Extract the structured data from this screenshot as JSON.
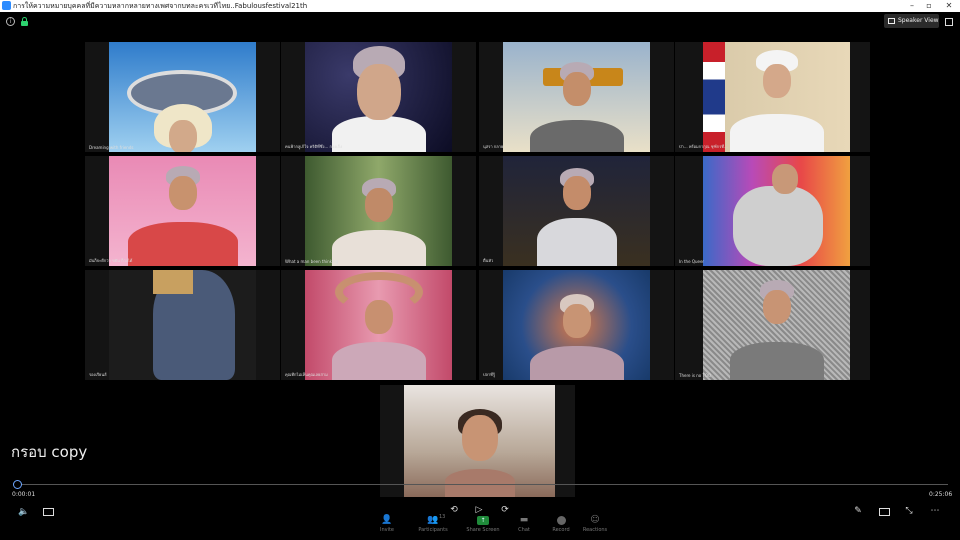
{
  "window": {
    "title": "การให้ความหมายบุคคลที่มีความหลากหลายทางเพศจากบทละครเวทีไทย..Fabulousfestival21th"
  },
  "toolbar_top": {
    "speaker_view_label": "Speaker View"
  },
  "tiles": [
    {
      "name": "Dreaming with friends",
      "bg": "#3c86c8"
    },
    {
      "name": "คนฟ้ากลูเก้ใจ คริติที่ซึ่ง... กองเก็ง",
      "bg": "#1a1a3a"
    },
    {
      "name": "นุสรา กลาย",
      "bg": "#8fa6c0"
    },
    {
      "name": "ป่า... พร้อมกากุณ ชุฑ์กรที่...",
      "bg": "#d8c9a8"
    },
    {
      "name": "มันก็จะดีกว่า ขยัน ก็วงได้",
      "bg": "#e68fb0"
    },
    {
      "name": "What a man been thinking",
      "bg": "#5f7a48"
    },
    {
      "name": "ตื่นหัว",
      "bg": "#20243a"
    },
    {
      "name": "In the Queer",
      "bg": "#7a58a8"
    },
    {
      "name": "รองเรียนส์",
      "bg": "#222222"
    },
    {
      "name": "คุณทีกไม่เห็นคุณเลยสาม",
      "bg": "#c24a6a"
    },
    {
      "name": "ปลาที่รู้",
      "bg": "#2a4e8a"
    },
    {
      "name": "There is no TOO",
      "bg": "#9a9a9a"
    },
    {
      "name": "",
      "bg": "#a89a8a"
    }
  ],
  "caption": "กรอบ copy",
  "playback": {
    "current_time": "0:00:01",
    "total_time": "0:25:06",
    "progress": 0.0007
  },
  "toolbar": {
    "invite": "Invite",
    "participants": "Participants",
    "participants_count": "13",
    "share_screen": "Share Screen",
    "chat": "Chat",
    "record": "Record",
    "reactions": "Reactions"
  },
  "colors": {
    "background": "#000000",
    "share_green": "#1f8a3a",
    "scrub_knob": "#6da6ff",
    "lock_green": "#2dd36f"
  }
}
